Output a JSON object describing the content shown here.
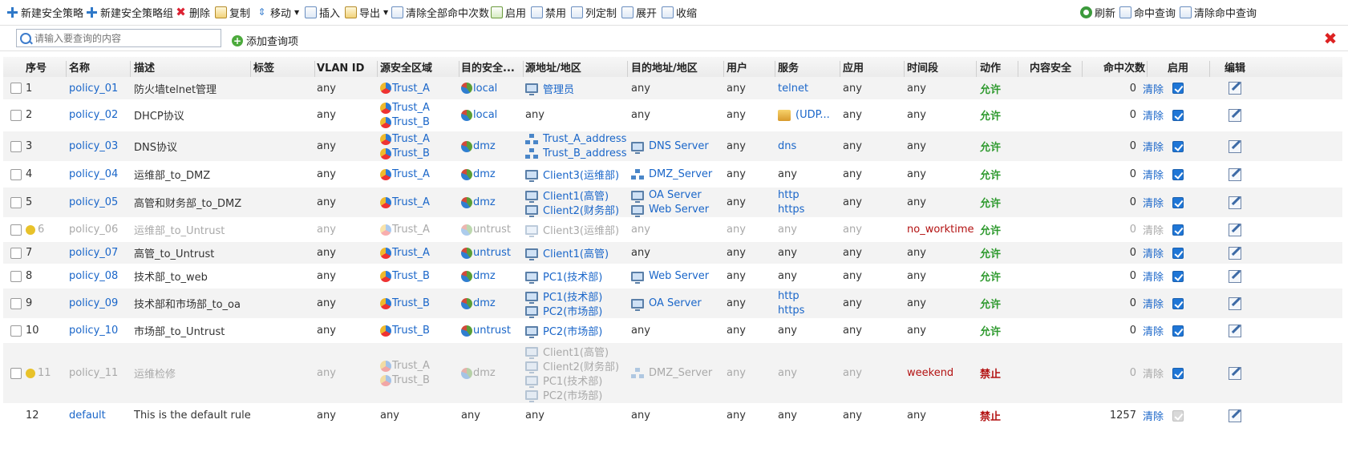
{
  "toolbar": {
    "new_policy": "新建安全策略",
    "new_group": "新建安全策略组",
    "delete": "删除",
    "copy": "复制",
    "move": "移动",
    "insert": "插入",
    "export": "导出",
    "clear_hits": "清除全部命中次数",
    "enable": "启用",
    "disable": "禁用",
    "customize_columns": "列定制",
    "expand": "展开",
    "collapse": "收缩",
    "refresh": "刷新",
    "hit_query": "命中查询",
    "clear_hit_query": "清除命中查询"
  },
  "search": {
    "placeholder": "请输入要查询的内容",
    "add_query": "添加查询项"
  },
  "columns": {
    "seq": "序号",
    "name": "名称",
    "desc": "描述",
    "tag": "标签",
    "vlan": "VLAN ID",
    "src_zone": "源安全区域",
    "dst_zone": "目的安全...",
    "src_addr": "源地址/地区",
    "dst_addr": "目的地址/地区",
    "user": "用户",
    "service": "服务",
    "app": "应用",
    "time": "时间段",
    "action": "动作",
    "content": "内容安全",
    "hits": "命中次数",
    "enabled": "启用",
    "edit": "编辑"
  },
  "clear_label": "清除",
  "rows": [
    {
      "seq": "1",
      "name": "policy_01",
      "desc": "防火墙telnet管理",
      "vlan": "any",
      "src_zone": [
        "Trust_A"
      ],
      "dst_zone": "local",
      "src_addr": [
        [
          "pc",
          "管理员"
        ]
      ],
      "dst_addr": [
        [
          "",
          "any"
        ]
      ],
      "user": "any",
      "service": [
        [
          "",
          "telnet"
        ]
      ],
      "app": "any",
      "time": "any",
      "action": "允许",
      "hits": "0",
      "enabled": "on"
    },
    {
      "seq": "2",
      "name": "policy_02",
      "desc": "DHCP协议",
      "vlan": "any",
      "src_zone": [
        "Trust_A",
        "Trust_B"
      ],
      "dst_zone": "local",
      "src_addr": [
        [
          "",
          "any"
        ]
      ],
      "dst_addr": [
        [
          "",
          "any"
        ]
      ],
      "user": "any",
      "service": [
        [
          "svc",
          "(UDP..."
        ]
      ],
      "app": "any",
      "time": "any",
      "action": "允许",
      "hits": "0",
      "enabled": "on"
    },
    {
      "seq": "3",
      "name": "policy_03",
      "desc": "DNS协议",
      "vlan": "any",
      "src_zone": [
        "Trust_A",
        "Trust_B"
      ],
      "dst_zone": "dmz",
      "src_addr": [
        [
          "net",
          "Trust_A_address"
        ],
        [
          "net",
          "Trust_B_address"
        ]
      ],
      "dst_addr": [
        [
          "pc",
          "DNS Server"
        ]
      ],
      "user": "any",
      "service": [
        [
          "",
          "dns"
        ]
      ],
      "app": "any",
      "time": "any",
      "action": "允许",
      "hits": "0",
      "enabled": "on"
    },
    {
      "seq": "4",
      "name": "policy_04",
      "desc": "运维部_to_DMZ",
      "vlan": "any",
      "src_zone": [
        "Trust_A"
      ],
      "dst_zone": "dmz",
      "src_addr": [
        [
          "pc",
          "Client3(运维部)"
        ]
      ],
      "dst_addr": [
        [
          "net",
          "DMZ_Server"
        ]
      ],
      "user": "any",
      "service": [
        [
          "",
          "any"
        ]
      ],
      "app": "any",
      "time": "any",
      "action": "允许",
      "hits": "0",
      "enabled": "on"
    },
    {
      "seq": "5",
      "name": "policy_05",
      "desc": "高管和财务部_to_DMZ",
      "vlan": "any",
      "src_zone": [
        "Trust_A"
      ],
      "dst_zone": "dmz",
      "src_addr": [
        [
          "pc",
          "Client1(高管)"
        ],
        [
          "pc",
          "Client2(财务部)"
        ]
      ],
      "dst_addr": [
        [
          "pc",
          "OA Server"
        ],
        [
          "pc",
          "Web Server"
        ]
      ],
      "user": "any",
      "service": [
        [
          "",
          "http"
        ],
        [
          "",
          "https"
        ]
      ],
      "app": "any",
      "time": "any",
      "action": "允许",
      "hits": "0",
      "enabled": "on"
    },
    {
      "seq": "6",
      "name": "policy_06",
      "desc": "运维部_to_Untrust",
      "vlan": "any",
      "src_zone": [
        "Trust_A"
      ],
      "dst_zone": "untrust",
      "src_addr": [
        [
          "pc",
          "Client3(运维部)"
        ]
      ],
      "dst_addr": [
        [
          "",
          "any"
        ]
      ],
      "user": "any",
      "service": [
        [
          "",
          "any"
        ]
      ],
      "app": "any",
      "time": "no_worktime",
      "action": "允许",
      "hits": "0",
      "enabled": "on",
      "disabled": true
    },
    {
      "seq": "7",
      "name": "policy_07",
      "desc": "高管_to_Untrust",
      "vlan": "any",
      "src_zone": [
        "Trust_A"
      ],
      "dst_zone": "untrust",
      "src_addr": [
        [
          "pc",
          "Client1(高管)"
        ]
      ],
      "dst_addr": [
        [
          "",
          "any"
        ]
      ],
      "user": "any",
      "service": [
        [
          "",
          "any"
        ]
      ],
      "app": "any",
      "time": "any",
      "action": "允许",
      "hits": "0",
      "enabled": "on"
    },
    {
      "seq": "8",
      "name": "policy_08",
      "desc": "技术部_to_web",
      "vlan": "any",
      "src_zone": [
        "Trust_B"
      ],
      "dst_zone": "dmz",
      "src_addr": [
        [
          "pc",
          "PC1(技术部)"
        ]
      ],
      "dst_addr": [
        [
          "pc",
          "Web Server"
        ]
      ],
      "user": "any",
      "service": [
        [
          "",
          "any"
        ]
      ],
      "app": "any",
      "time": "any",
      "action": "允许",
      "hits": "0",
      "enabled": "on"
    },
    {
      "seq": "9",
      "name": "policy_09",
      "desc": "技术部和市场部_to_oa",
      "vlan": "any",
      "src_zone": [
        "Trust_B"
      ],
      "dst_zone": "dmz",
      "src_addr": [
        [
          "pc",
          "PC1(技术部)"
        ],
        [
          "pc",
          "PC2(市场部)"
        ]
      ],
      "dst_addr": [
        [
          "pc",
          "OA Server"
        ]
      ],
      "user": "any",
      "service": [
        [
          "",
          "http"
        ],
        [
          "",
          "https"
        ]
      ],
      "app": "any",
      "time": "any",
      "action": "允许",
      "hits": "0",
      "enabled": "on"
    },
    {
      "seq": "10",
      "name": "policy_10",
      "desc": "市场部_to_Untrust",
      "vlan": "any",
      "src_zone": [
        "Trust_B"
      ],
      "dst_zone": "untrust",
      "src_addr": [
        [
          "pc",
          "PC2(市场部)"
        ]
      ],
      "dst_addr": [
        [
          "",
          "any"
        ]
      ],
      "user": "any",
      "service": [
        [
          "",
          "any"
        ]
      ],
      "app": "any",
      "time": "any",
      "action": "允许",
      "hits": "0",
      "enabled": "on"
    },
    {
      "seq": "11",
      "name": "policy_11",
      "desc": "运维检修",
      "vlan": "any",
      "src_zone": [
        "Trust_A",
        "Trust_B"
      ],
      "dst_zone": "dmz",
      "src_addr": [
        [
          "pc",
          "Client1(高管)"
        ],
        [
          "pc",
          "Client2(财务部)"
        ],
        [
          "pc",
          "PC1(技术部)"
        ],
        [
          "pc",
          "PC2(市场部)"
        ]
      ],
      "dst_addr": [
        [
          "net",
          "DMZ_Server"
        ]
      ],
      "user": "any",
      "service": [
        [
          "",
          "any"
        ]
      ],
      "app": "any",
      "time": "weekend",
      "action": "禁止",
      "hits": "0",
      "enabled": "on",
      "disabled": true
    },
    {
      "seq": "12",
      "name": "default",
      "desc": "This is the default rule",
      "vlan": "any",
      "src_zone_plain": "any",
      "dst_zone_plain": "any",
      "src_addr": [
        [
          "",
          "any"
        ]
      ],
      "dst_addr": [
        [
          "",
          "any"
        ]
      ],
      "user": "any",
      "service": [
        [
          "",
          "any"
        ]
      ],
      "app": "any",
      "time": "any",
      "action": "禁止",
      "hits": "1257",
      "enabled": "gray"
    }
  ]
}
